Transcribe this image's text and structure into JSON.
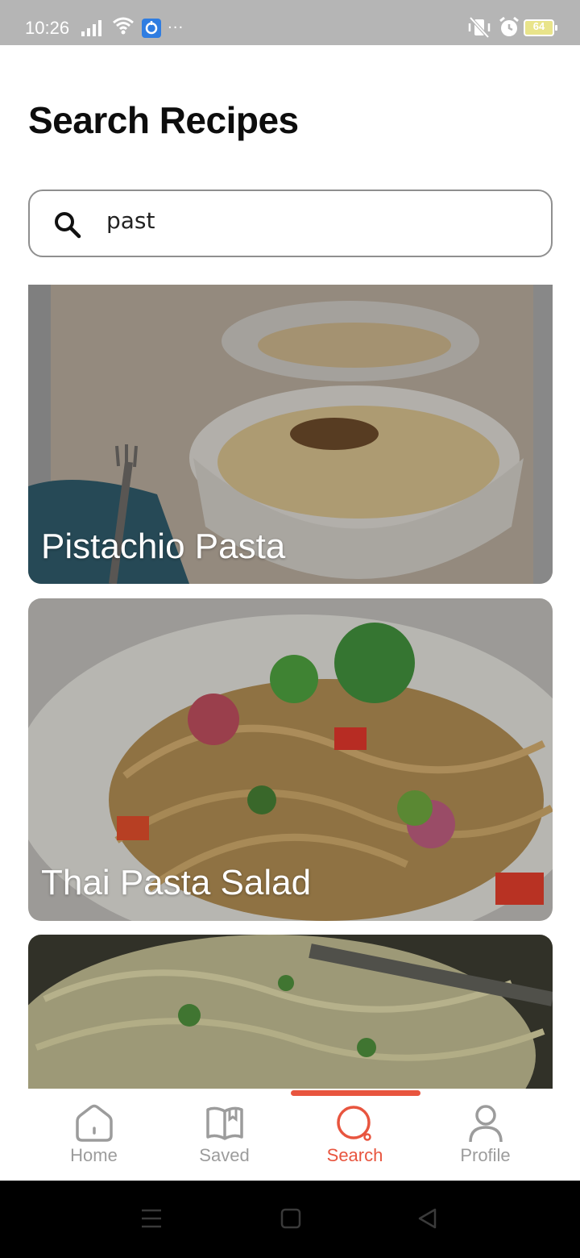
{
  "status_bar": {
    "time": "10:26",
    "battery_level": "64",
    "icons": [
      "signal-icon",
      "wifi-icon",
      "app-notification-icon",
      "more-dots-icon",
      "vibrate-mute-icon",
      "alarm-icon",
      "battery-icon"
    ]
  },
  "page": {
    "title": "Search Recipes"
  },
  "search": {
    "value": "past",
    "icon": "search-icon"
  },
  "results": [
    {
      "title": "Pistachio Pasta"
    },
    {
      "title": "Thai Pasta Salad"
    },
    {
      "title": ""
    }
  ],
  "bottom_nav": {
    "active": "Search",
    "accent_color": "#e8553f",
    "inactive_color": "#9c9c9c",
    "items": [
      {
        "label": "Home",
        "icon": "home-icon"
      },
      {
        "label": "Saved",
        "icon": "book-icon"
      },
      {
        "label": "Search",
        "icon": "search-icon"
      },
      {
        "label": "Profile",
        "icon": "person-icon"
      }
    ]
  },
  "system_nav": {
    "icons": [
      "menu-icon",
      "square-home-icon",
      "back-triangle-icon"
    ]
  }
}
